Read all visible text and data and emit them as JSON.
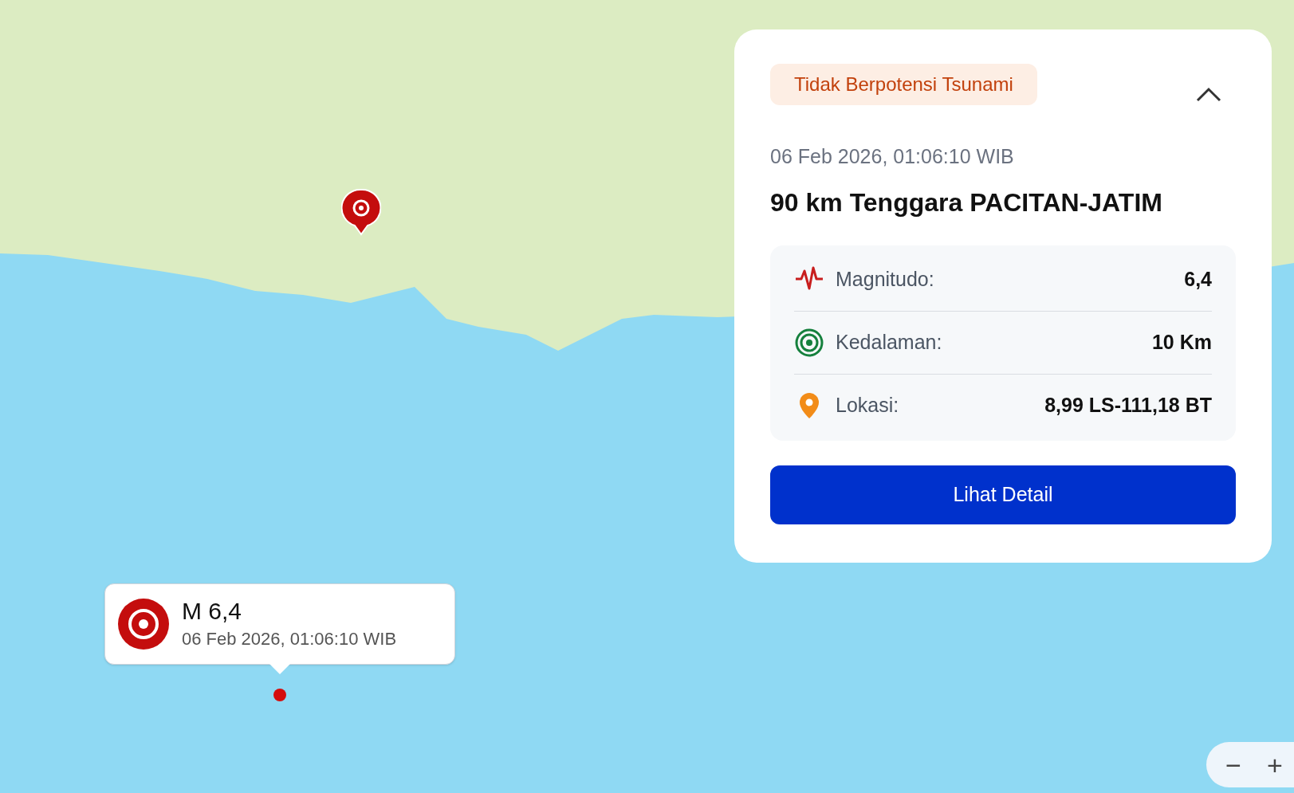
{
  "panel": {
    "tsunami_badge": "Tidak Berpotensi Tsunami",
    "expanded": true,
    "datetime": "06 Feb 2026, 01:06:10 WIB",
    "location_title": "90 km Tenggara PACITAN-JATIM",
    "details": [
      {
        "kind": "magnitude",
        "label": "Magnitudo:",
        "value": "6,4"
      },
      {
        "kind": "depth",
        "label": "Kedalaman:",
        "value": "10 Km"
      },
      {
        "kind": "location",
        "label": "Lokasi:",
        "value": "8,99 LS-111,18 BT"
      }
    ],
    "button": "Lihat Detail"
  },
  "popup": {
    "magnitude": "M 6,4",
    "datetime": "06 Feb 2026, 01:06:10 WIB"
  },
  "zoom_controls": [
    "−",
    "+"
  ]
}
